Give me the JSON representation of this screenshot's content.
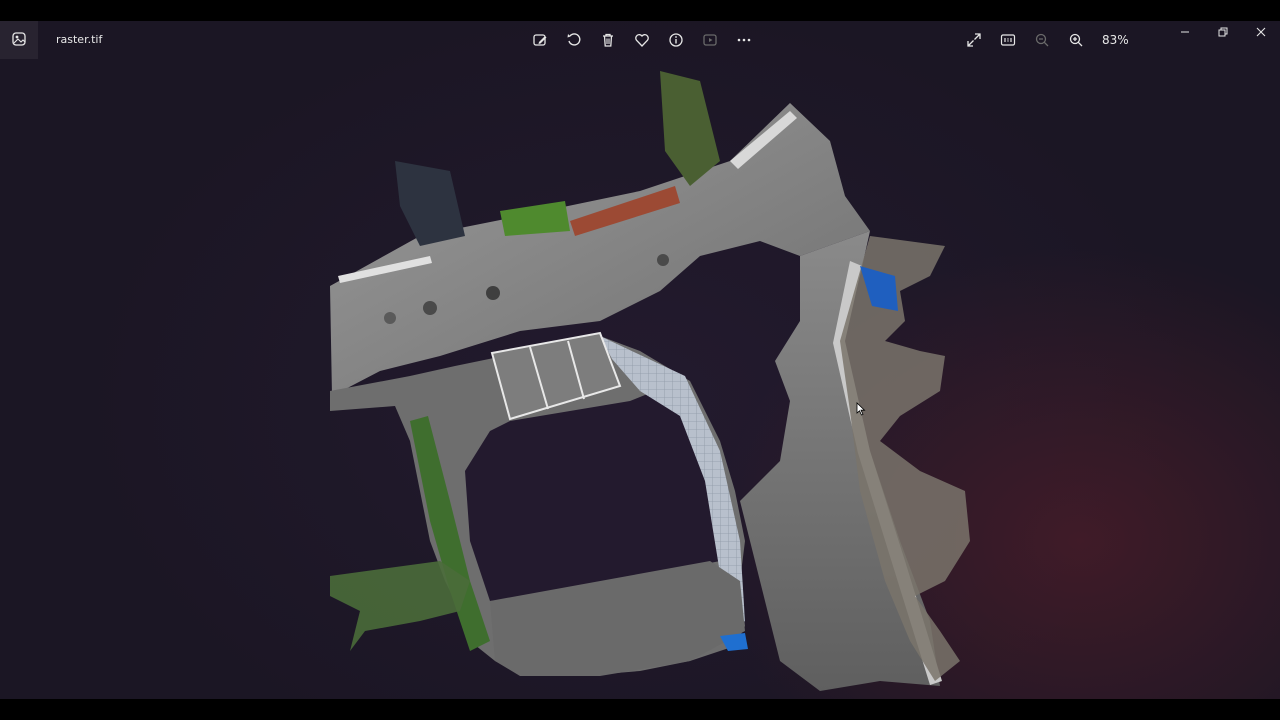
{
  "window": {
    "file_name": "raster.tif",
    "zoom_level": "83%"
  },
  "toolbar": {
    "center_icons": [
      "edit-image-icon",
      "rotate-icon",
      "delete-icon",
      "favorite-heart-icon",
      "info-icon",
      "slideshow-icon",
      "more-options-icon"
    ],
    "right_icons": [
      "fullscreen-icon",
      "actual-size-icon",
      "zoom-out-icon",
      "zoom-in-icon"
    ]
  },
  "window_controls": [
    "minimize-icon",
    "restore-icon",
    "close-icon"
  ],
  "colors": {
    "background": "#1b1624",
    "icon": "#e6e6e6",
    "ground": "#8c8c8c"
  }
}
